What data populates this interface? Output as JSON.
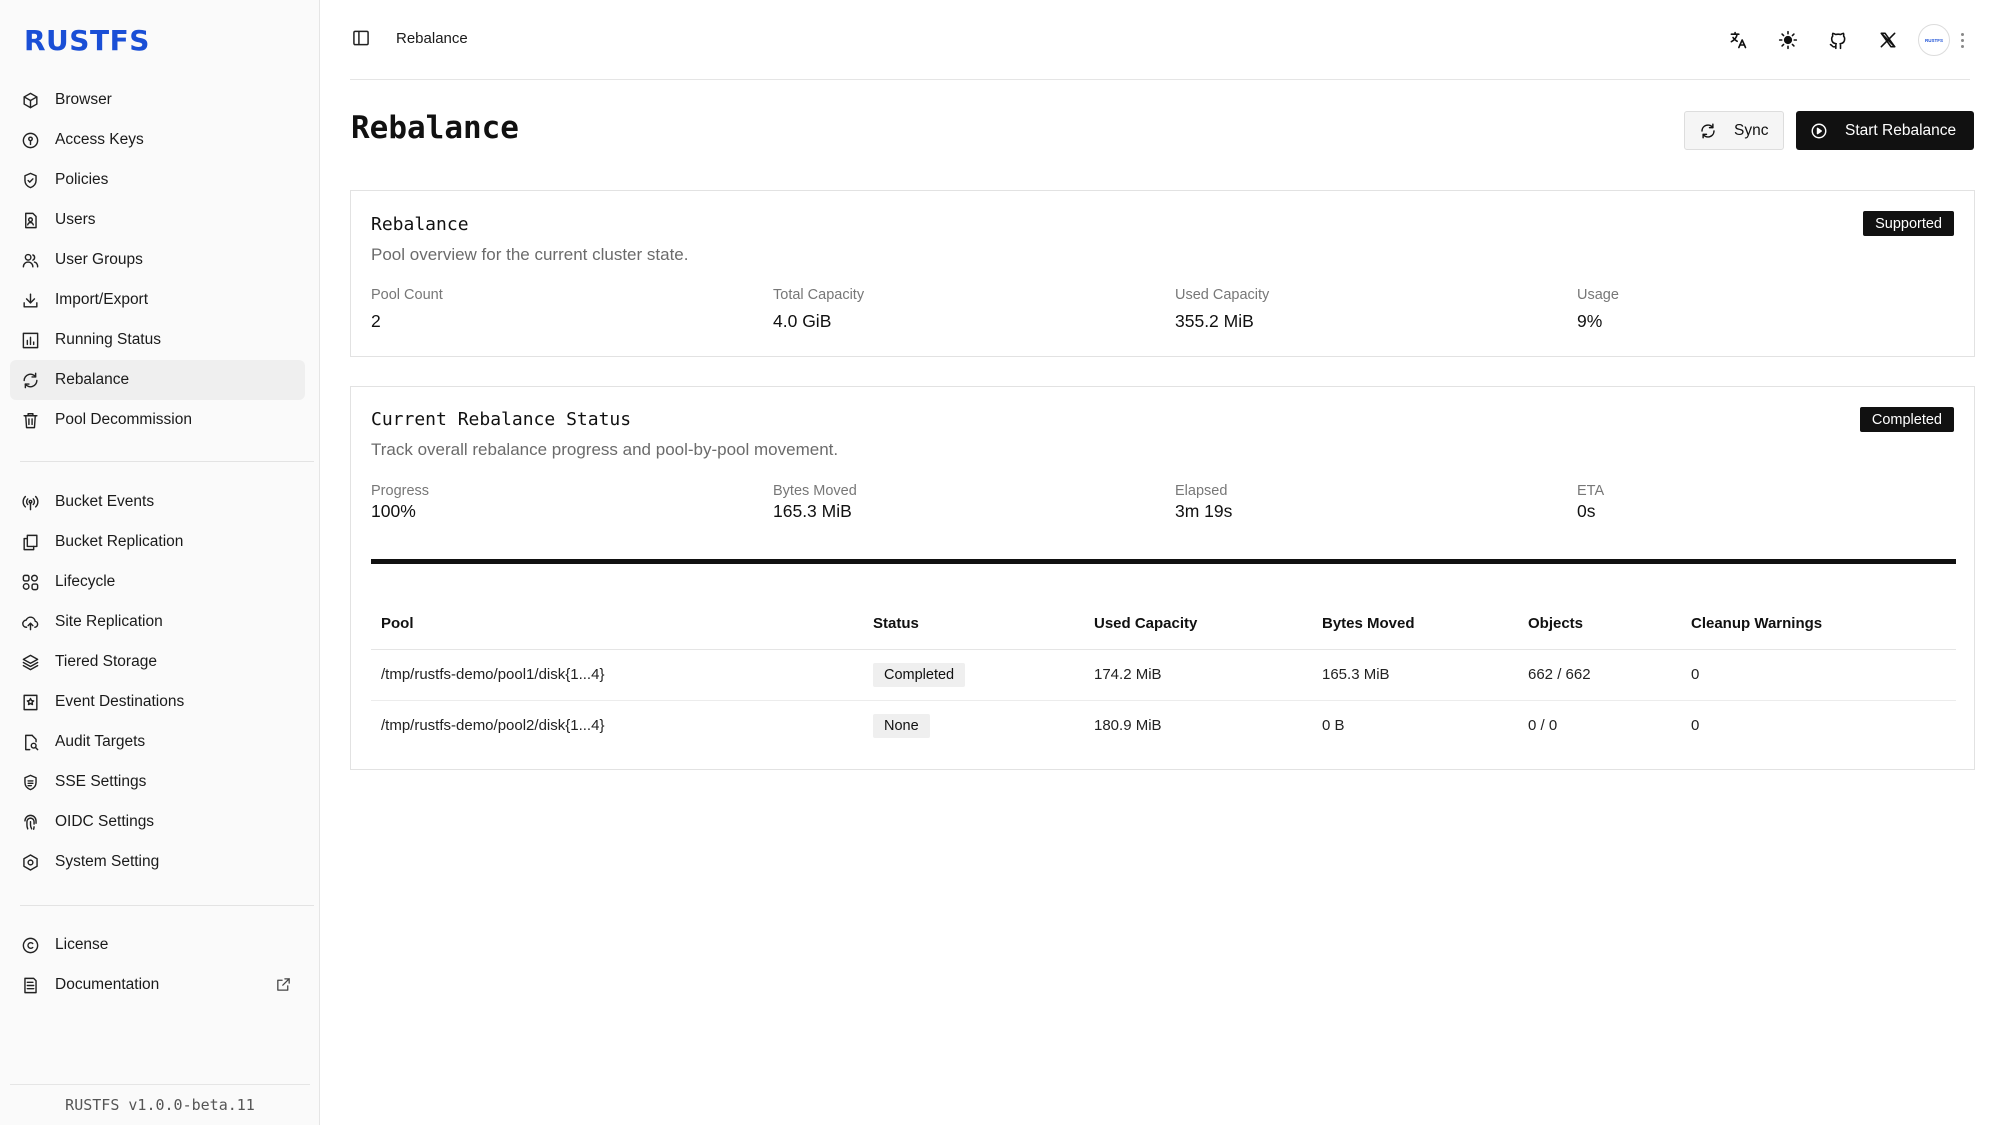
{
  "app": {
    "logo": "RUSTFS",
    "version": "RUSTFS v1.0.0-beta.11",
    "avatar_text": "RUSTFS"
  },
  "sidebar": {
    "main": [
      {
        "label": "Browser",
        "icon": "cube-icon"
      },
      {
        "label": "Access Keys",
        "icon": "key-icon"
      },
      {
        "label": "Policies",
        "icon": "shield-icon"
      },
      {
        "label": "Users",
        "icon": "user-file-icon"
      },
      {
        "label": "User Groups",
        "icon": "users-icon"
      },
      {
        "label": "Import/Export",
        "icon": "download-icon"
      },
      {
        "label": "Running Status",
        "icon": "bar-chart-icon"
      },
      {
        "label": "Rebalance",
        "icon": "refresh-icon",
        "active": true
      },
      {
        "label": "Pool Decommission",
        "icon": "trash-icon"
      }
    ],
    "secondary": [
      {
        "label": "Bucket Events",
        "icon": "broadcast-icon"
      },
      {
        "label": "Bucket Replication",
        "icon": "copy-icon"
      },
      {
        "label": "Lifecycle",
        "icon": "lifecycle-icon"
      },
      {
        "label": "Site Replication",
        "icon": "cloud-upload-icon"
      },
      {
        "label": "Tiered Storage",
        "icon": "layers-icon"
      },
      {
        "label": "Event Destinations",
        "icon": "bookmark-icon"
      },
      {
        "label": "Audit Targets",
        "icon": "file-search-icon"
      },
      {
        "label": "SSE Settings",
        "icon": "encryption-icon"
      },
      {
        "label": "OIDC Settings",
        "icon": "fingerprint-icon"
      },
      {
        "label": "System Setting",
        "icon": "settings-hex-icon"
      }
    ],
    "footer": [
      {
        "label": "License",
        "icon": "copyright-icon"
      },
      {
        "label": "Documentation",
        "icon": "document-icon",
        "external": true
      }
    ]
  },
  "topbar": {
    "breadcrumb": "Rebalance",
    "icons": [
      "translate-icon",
      "sun-icon",
      "github-icon",
      "x-logo-icon"
    ]
  },
  "page": {
    "title": "Rebalance",
    "sync_label": "Sync",
    "start_label": "Start Rebalance"
  },
  "overview": {
    "title": "Rebalance",
    "description": "Pool overview for the current cluster state.",
    "badge": "Supported",
    "stats": [
      {
        "label": "Pool Count",
        "value": "2"
      },
      {
        "label": "Total Capacity",
        "value": "4.0 GiB"
      },
      {
        "label": "Used Capacity",
        "value": "355.2 MiB"
      },
      {
        "label": "Usage",
        "value": "9%"
      }
    ]
  },
  "status": {
    "title": "Current Rebalance Status",
    "description": "Track overall rebalance progress and pool-by-pool movement.",
    "badge": "Completed",
    "progress_fraction": 1.0,
    "stats": [
      {
        "label": "Progress",
        "value": "100%"
      },
      {
        "label": "Bytes Moved",
        "value": "165.3 MiB"
      },
      {
        "label": "Elapsed",
        "value": "3m 19s"
      },
      {
        "label": "ETA",
        "value": "0s"
      }
    ],
    "table": {
      "headers": [
        "Pool",
        "Status",
        "Used Capacity",
        "Bytes Moved",
        "Objects",
        "Cleanup Warnings"
      ],
      "rows": [
        [
          "/tmp/rustfs-demo/pool1/disk{1...4}",
          "Completed",
          "174.2 MiB",
          "165.3 MiB",
          "662 / 662",
          "0"
        ],
        [
          "/tmp/rustfs-demo/pool2/disk{1...4}",
          "None",
          "180.9 MiB",
          "0 B",
          "0 / 0",
          "0"
        ]
      ]
    }
  }
}
